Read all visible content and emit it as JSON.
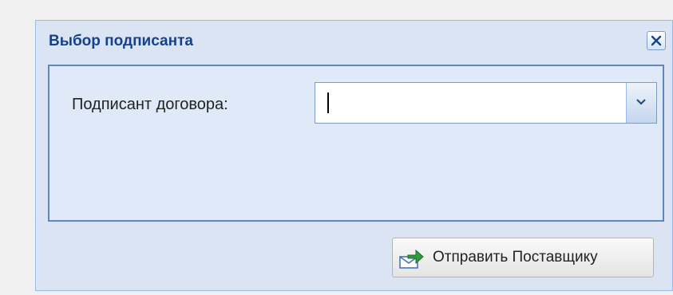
{
  "dialog": {
    "title": "Выбор подписанта",
    "close_icon": "close-icon"
  },
  "form": {
    "signer_label": "Подписант договора:",
    "signer_value": "",
    "dropdown_icon": "chevron-down-icon"
  },
  "footer": {
    "send_label": "Отправить Поставщику",
    "send_icon": "send-envelope-icon"
  },
  "colors": {
    "title_text": "#15428b",
    "panel_border": "#5f86bf",
    "window_background": "#dbe4f2"
  }
}
